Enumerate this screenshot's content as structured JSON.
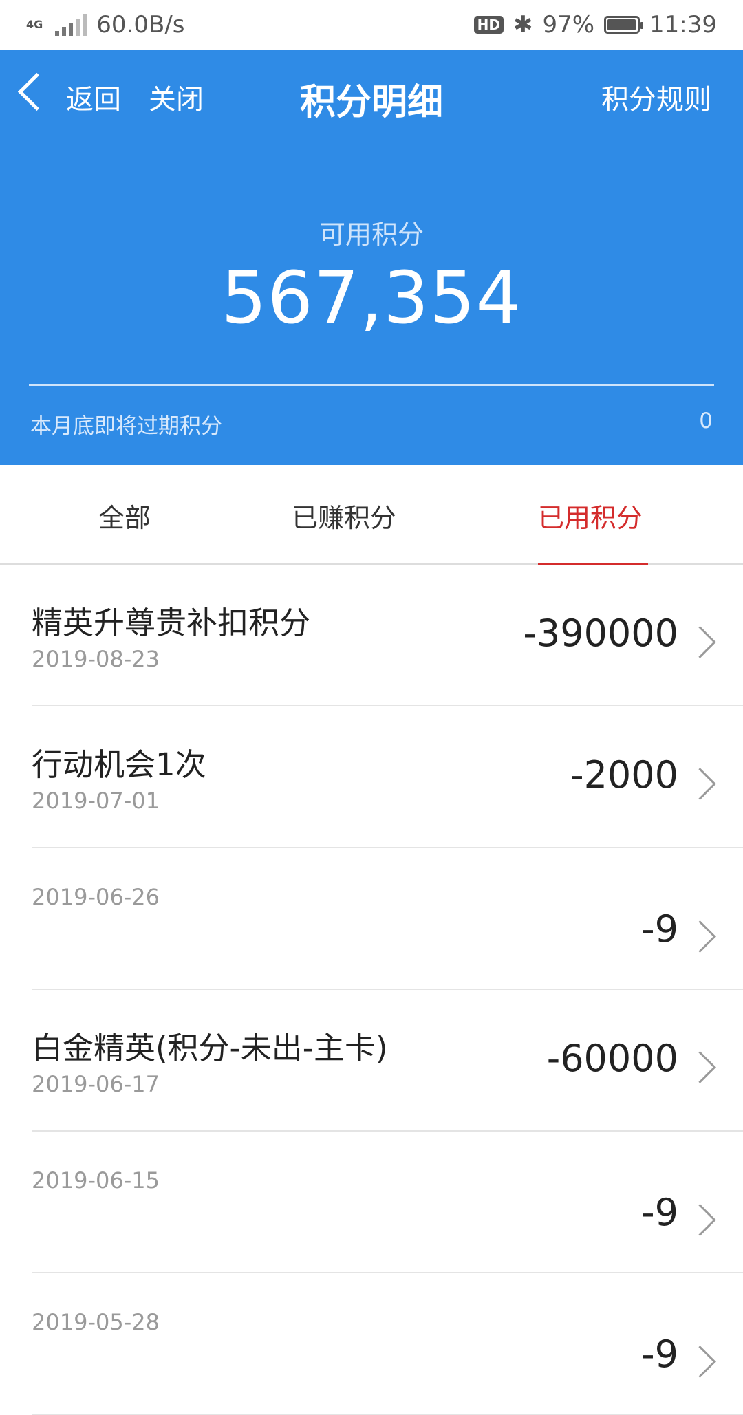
{
  "status_bar": {
    "network": "4G",
    "speed": "60.0B/s",
    "hd": "HD",
    "battery": "97%",
    "time": "11:39",
    "battery_level": 0.97
  },
  "nav": {
    "back_label": "返回",
    "close_label": "关闭",
    "title": "积分明细",
    "rules_label": "积分规则"
  },
  "summary": {
    "available_label": "可用积分",
    "available_value": "567,354",
    "expire_label": "本月底即将过期积分",
    "expire_value": "0"
  },
  "tabs": [
    {
      "label": "全部",
      "active": false
    },
    {
      "label": "已赚积分",
      "active": false
    },
    {
      "label": "已用积分",
      "active": true
    }
  ],
  "records": [
    {
      "title": "精英升尊贵补扣积分",
      "date": "2019-08-23",
      "amount": "-390000"
    },
    {
      "title": "行动机会1次",
      "date": "2019-07-01",
      "amount": "-2000"
    },
    {
      "title": "",
      "date": "2019-06-26",
      "amount": "-9"
    },
    {
      "title": "白金精英(积分-未出-主卡)",
      "date": "2019-06-17",
      "amount": "-60000"
    },
    {
      "title": "",
      "date": "2019-06-15",
      "amount": "-9"
    },
    {
      "title": "",
      "date": "2019-05-28",
      "amount": "-9"
    }
  ],
  "colors": {
    "header_bg": "#2f8be6",
    "active_tab": "#d42c2c"
  }
}
